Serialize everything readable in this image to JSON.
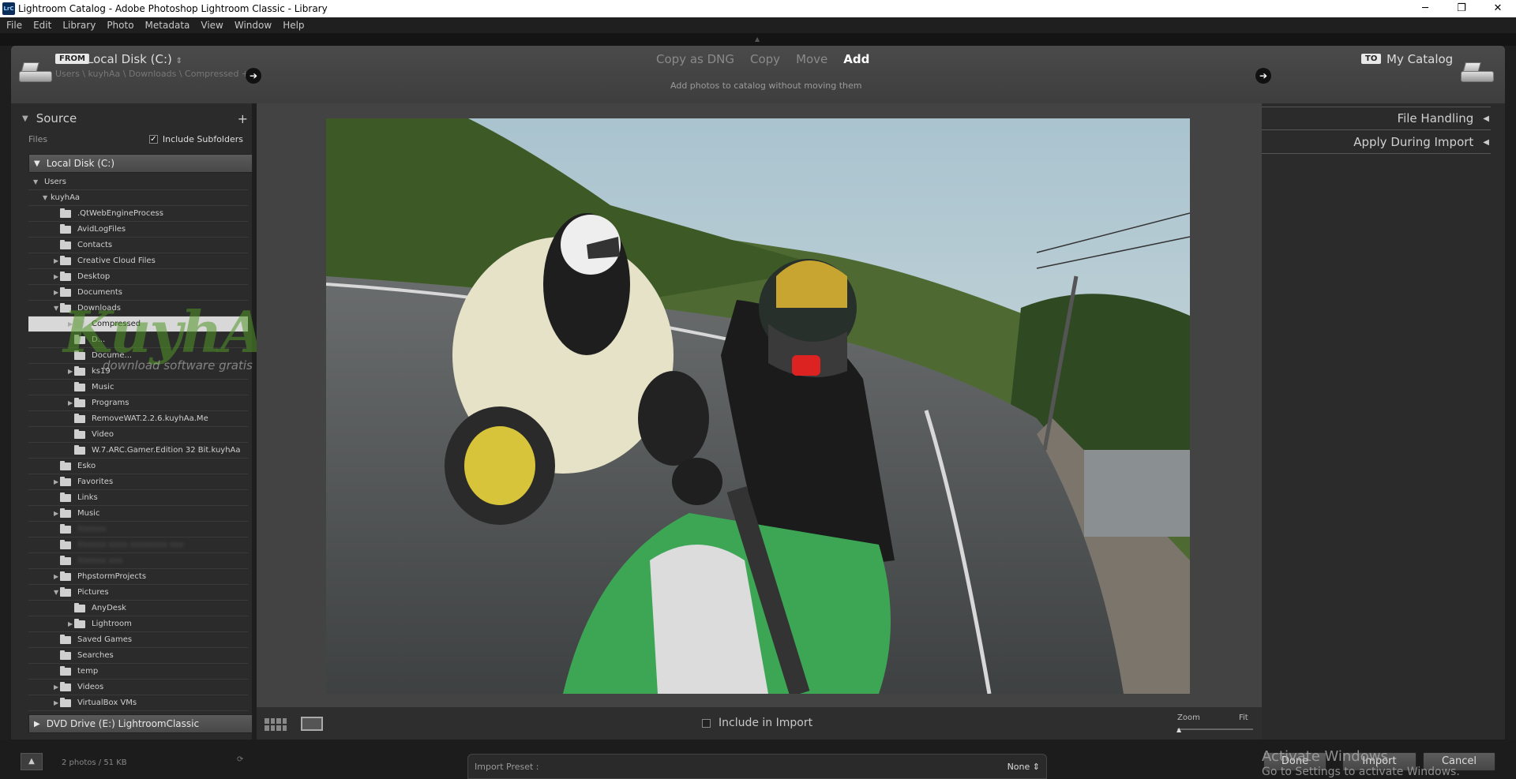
{
  "window": {
    "title": "Lightroom Catalog - Adobe Photoshop Lightroom Classic - Library",
    "app_icon": "LrC",
    "controls": [
      "─",
      "❐",
      "✕"
    ]
  },
  "menu": [
    "File",
    "Edit",
    "Library",
    "Photo",
    "Metadata",
    "View",
    "Window",
    "Help"
  ],
  "header": {
    "from_tag": "FROM",
    "source_name": "Local Disk (C:)",
    "source_path": "Users \\ kuyhAa \\ Downloads \\ Compressed +",
    "modes": [
      "Copy as DNG",
      "Copy",
      "Move",
      "Add"
    ],
    "active_mode": "Add",
    "mode_description": "Add photos to catalog without moving them",
    "to_tag": "TO",
    "dest_name": "My Catalog"
  },
  "source_panel": {
    "title": "Source",
    "plus": "+",
    "files_label": "Files",
    "include_subfolders": "Include Subfolders",
    "volume_c": "Local Disk (C:)",
    "volume_e": "DVD Drive (E:) LightroomClassic"
  },
  "tree": [
    {
      "label": "Users",
      "level": 0,
      "expanded": true,
      "folder": false
    },
    {
      "label": "kuyhAa",
      "level": 1,
      "expanded": true,
      "folder": false
    },
    {
      "label": ".QtWebEngineProcess",
      "level": 2,
      "folder": true
    },
    {
      "label": "AvidLogFiles",
      "level": 2,
      "folder": true
    },
    {
      "label": "Contacts",
      "level": 2,
      "folder": true
    },
    {
      "label": "Creative Cloud Files",
      "level": 2,
      "folder": true,
      "collapsed": true
    },
    {
      "label": "Desktop",
      "level": 2,
      "folder": true,
      "collapsed": true
    },
    {
      "label": "Documents",
      "level": 2,
      "folder": true,
      "collapsed": true
    },
    {
      "label": "Downloads",
      "level": 2,
      "folder": true,
      "expanded": true
    },
    {
      "label": "Compressed",
      "level": 3,
      "folder": true,
      "collapsed": true,
      "selected": true
    },
    {
      "label": "D...",
      "level": 3,
      "folder": true
    },
    {
      "label": "Docume...",
      "level": 3,
      "folder": true
    },
    {
      "label": "ks19",
      "level": 3,
      "folder": true,
      "collapsed": true
    },
    {
      "label": "Music",
      "level": 3,
      "folder": true
    },
    {
      "label": "Programs",
      "level": 3,
      "folder": true,
      "collapsed": true
    },
    {
      "label": "RemoveWAT.2.2.6.kuyhAa.Me",
      "level": 3,
      "folder": true
    },
    {
      "label": "Video",
      "level": 3,
      "folder": true
    },
    {
      "label": "W.7.ARC.Gamer.Edition 32 Bit.kuyhAa",
      "level": 3,
      "folder": true
    },
    {
      "label": "Esko",
      "level": 2,
      "folder": true
    },
    {
      "label": "Favorites",
      "level": 2,
      "folder": true,
      "collapsed": true
    },
    {
      "label": "Links",
      "level": 2,
      "folder": true
    },
    {
      "label": "Music",
      "level": 2,
      "folder": true,
      "collapsed": true
    },
    {
      "label": "Xxxxxx",
      "level": 2,
      "folder": true,
      "blurred": true
    },
    {
      "label": "Xxxxxx xxxx xxxxxxxx xxx",
      "level": 2,
      "folder": true,
      "blurred": true
    },
    {
      "label": "Xxxxxx xxx",
      "level": 2,
      "folder": true,
      "blurred": true
    },
    {
      "label": "PhpstormProjects",
      "level": 2,
      "folder": true,
      "collapsed": true
    },
    {
      "label": "Pictures",
      "level": 2,
      "folder": true,
      "expanded": true
    },
    {
      "label": "AnyDesk",
      "level": 3,
      "folder": true
    },
    {
      "label": "Lightroom",
      "level": 3,
      "folder": true,
      "collapsed": true
    },
    {
      "label": "Saved Games",
      "level": 2,
      "folder": true
    },
    {
      "label": "Searches",
      "level": 2,
      "folder": true
    },
    {
      "label": "temp",
      "level": 2,
      "folder": true
    },
    {
      "label": "Videos",
      "level": 2,
      "folder": true,
      "collapsed": true
    },
    {
      "label": "VirtualBox VMs",
      "level": 2,
      "folder": true,
      "collapsed": true
    }
  ],
  "watermark": {
    "logo": "KuyhAa.Me",
    "tagline": "download software gratis"
  },
  "toolbar": {
    "include_in_import": "Include in Import",
    "zoom_label": "Zoom",
    "fit_label": "Fit"
  },
  "right_panel": {
    "file_handling": "File Handling",
    "apply_during_import": "Apply During Import"
  },
  "bottom": {
    "photo_count": "2 photos / 51 KB",
    "import_preset_label": "Import Preset :",
    "import_preset_value": "None",
    "done": "Done",
    "import": "Import",
    "cancel": "Cancel",
    "activate_line1": "Activate Windows",
    "activate_line2": "Go to Settings to activate Windows."
  }
}
